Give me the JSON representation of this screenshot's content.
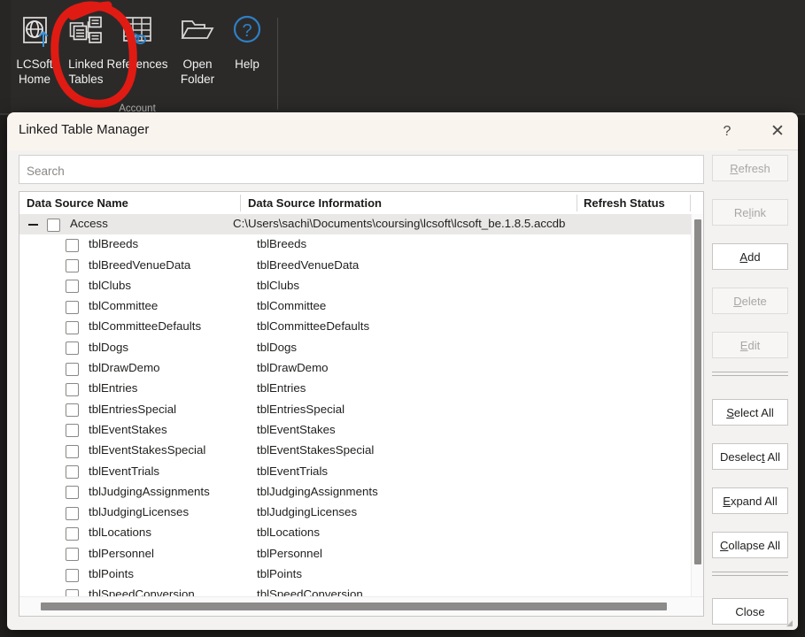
{
  "ribbon": {
    "buttons": [
      {
        "label": "LCSoft\nHome",
        "icon": "globe-upload-icon"
      },
      {
        "label": "Linked\nTables",
        "icon": "linked-tables-icon"
      },
      {
        "label": "References",
        "icon": "references-grid-link-icon"
      },
      {
        "label": "Open\nFolder",
        "icon": "open-folder-icon"
      },
      {
        "label": "Help",
        "icon": "help-question-icon"
      }
    ],
    "group_label": "Account",
    "annotation_color": "#e01b13"
  },
  "dialog": {
    "title": "Linked Table Manager",
    "help_glyph": "?",
    "close_glyph": "✕"
  },
  "search": {
    "placeholder": "Search",
    "value": ""
  },
  "buttons": [
    {
      "name": "refresh",
      "label": "Refresh",
      "accel": "R",
      "disabled": true
    },
    {
      "name": "relink",
      "label": "Relink",
      "accel": "l",
      "disabled": true
    },
    {
      "name": "add",
      "label": "Add",
      "accel": "A",
      "disabled": false
    },
    {
      "name": "delete",
      "label": "Delete",
      "accel": "D",
      "disabled": true
    },
    {
      "name": "edit",
      "label": "Edit",
      "accel": "E",
      "disabled": true
    },
    {
      "name": "select-all",
      "label": "Select All",
      "accel": "S",
      "disabled": false
    },
    {
      "name": "deselect-all",
      "label": "Deselect All",
      "accel": "t",
      "disabled": false
    },
    {
      "name": "expand-all",
      "label": "Expand All",
      "accel": "E",
      "disabled": false
    },
    {
      "name": "collapse-all",
      "label": "Collapse All",
      "accel": "C",
      "disabled": false
    },
    {
      "name": "close",
      "label": "Close",
      "accel": "",
      "disabled": false
    }
  ],
  "grid": {
    "columns": [
      "Data Source Name",
      "Data Source Information",
      "Refresh Status"
    ],
    "group": {
      "name": "Access",
      "information": "C:\\Users\\sachi\\Documents\\coursing\\lcsoft\\lcsoft_be.1.8.5.accdb",
      "refresh_status": "",
      "expanded": true,
      "checked": false,
      "expander_glyph": "−"
    },
    "rows": [
      {
        "name": "tblBreeds",
        "information": "tblBreeds",
        "refresh_status": "",
        "checked": false
      },
      {
        "name": "tblBreedVenueData",
        "information": "tblBreedVenueData",
        "refresh_status": "",
        "checked": false
      },
      {
        "name": "tblClubs",
        "information": "tblClubs",
        "refresh_status": "",
        "checked": false
      },
      {
        "name": "tblCommittee",
        "information": "tblCommittee",
        "refresh_status": "",
        "checked": false
      },
      {
        "name": "tblCommitteeDefaults",
        "information": "tblCommitteeDefaults",
        "refresh_status": "",
        "checked": false
      },
      {
        "name": "tblDogs",
        "information": "tblDogs",
        "refresh_status": "",
        "checked": false
      },
      {
        "name": "tblDrawDemo",
        "information": "tblDrawDemo",
        "refresh_status": "",
        "checked": false
      },
      {
        "name": "tblEntries",
        "information": "tblEntries",
        "refresh_status": "",
        "checked": false
      },
      {
        "name": "tblEntriesSpecial",
        "information": "tblEntriesSpecial",
        "refresh_status": "",
        "checked": false
      },
      {
        "name": "tblEventStakes",
        "information": "tblEventStakes",
        "refresh_status": "",
        "checked": false
      },
      {
        "name": "tblEventStakesSpecial",
        "information": "tblEventStakesSpecial",
        "refresh_status": "",
        "checked": false
      },
      {
        "name": "tblEventTrials",
        "information": "tblEventTrials",
        "refresh_status": "",
        "checked": false
      },
      {
        "name": "tblJudgingAssignments",
        "information": "tblJudgingAssignments",
        "refresh_status": "",
        "checked": false
      },
      {
        "name": "tblJudgingLicenses",
        "information": "tblJudgingLicenses",
        "refresh_status": "",
        "checked": false
      },
      {
        "name": "tblLocations",
        "information": "tblLocations",
        "refresh_status": "",
        "checked": false
      },
      {
        "name": "tblPersonnel",
        "information": "tblPersonnel",
        "refresh_status": "",
        "checked": false
      },
      {
        "name": "tblPoints",
        "information": "tblPoints",
        "refresh_status": "",
        "checked": false
      },
      {
        "name": "tblSpeedConversion",
        "information": "tblSpeedConversion",
        "refresh_status": "",
        "checked": false
      }
    ]
  }
}
